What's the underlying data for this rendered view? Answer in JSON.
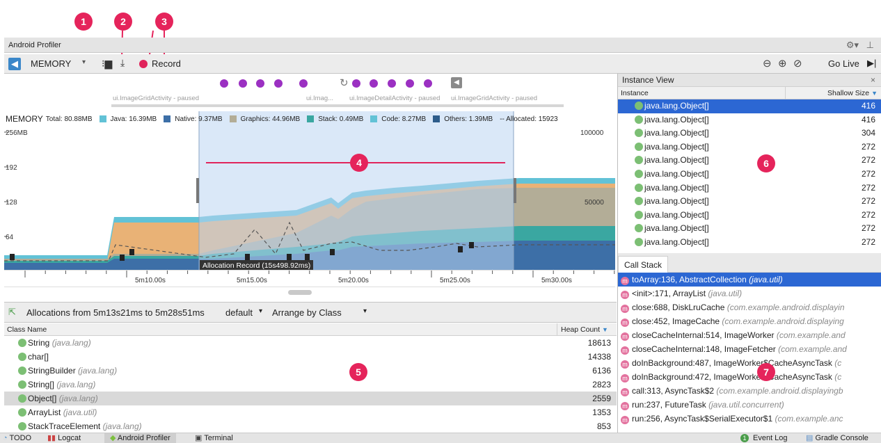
{
  "callouts": [
    "1",
    "2",
    "3",
    "4",
    "5",
    "6",
    "7"
  ],
  "window": {
    "title": "Android Profiler"
  },
  "toolbar": {
    "profiler_select": "MEMORY",
    "record_label": "Record",
    "go_live": "Go Live"
  },
  "events": {
    "activities": [
      "ui.ImageGridActivity - paused",
      "ui.Imag...",
      "ui.ImageDetailActivity - paused",
      "ui.ImageGridActivity - paused"
    ]
  },
  "chart": {
    "title": "MEMORY",
    "legend": {
      "total": "Total: 80.88MB",
      "java": "Java: 16.39MB",
      "native": "Native: 9.37MB",
      "graphics": "Graphics: 44.96MB",
      "stack": "Stack: 0.49MB",
      "code": "Code: 8.27MB",
      "others": "Others: 1.39MB",
      "allocated": "-- Allocated: 15923"
    },
    "colors": {
      "java": "#e9b276",
      "native": "#3d6fa7",
      "graphics": "#b3ad97",
      "stack": "#3aa7a1",
      "code": "#62c2d6",
      "others": "#2d5c8a",
      "selection": "#bcd6f3",
      "record": "#e0245b"
    },
    "allocation_tooltip": "Allocation Record (15s498.92ms)"
  },
  "chart_data": {
    "type": "area",
    "x_tick_labels": [
      "5m10.00s",
      "5m15.00s",
      "5m20.00s",
      "5m25.00s",
      "5m30.00s"
    ],
    "y_left_ticks": [
      "256MB",
      "192",
      "128",
      "64"
    ],
    "y_right_ticks": [
      "100000",
      "50000"
    ],
    "ylim_left": [
      0,
      256
    ],
    "ylim_right": [
      0,
      100000
    ],
    "series": [
      {
        "name": "Java",
        "values": [
          16.39
        ]
      },
      {
        "name": "Native",
        "values": [
          9.37
        ]
      },
      {
        "name": "Graphics",
        "values": [
          44.96
        ]
      },
      {
        "name": "Stack",
        "values": [
          0.49
        ]
      },
      {
        "name": "Code",
        "values": [
          8.27
        ]
      },
      {
        "name": "Others",
        "values": [
          1.39
        ]
      }
    ],
    "allocated": 15923,
    "total_mb": 80.88
  },
  "allocations": {
    "range_label": "Allocations from 5m13s21ms to 5m28s51ms",
    "heap_select": "default",
    "arrange_select": "Arrange by Class",
    "columns": [
      "Class Name",
      "Heap Count"
    ],
    "rows": [
      {
        "name": "String",
        "pkg": "(java.lang)",
        "count": "18613"
      },
      {
        "name": "char[]",
        "pkg": "",
        "count": "14338"
      },
      {
        "name": "StringBuilder",
        "pkg": "(java.lang)",
        "count": "6136"
      },
      {
        "name": "String[]",
        "pkg": "(java.lang)",
        "count": "2823"
      },
      {
        "name": "Object[]",
        "pkg": "(java.lang)",
        "count": "2559"
      },
      {
        "name": "ArrayList",
        "pkg": "(java.util)",
        "count": "1353"
      },
      {
        "name": "StackTraceElement",
        "pkg": "(java.lang)",
        "count": "853"
      }
    ]
  },
  "instance_view": {
    "title": "Instance View",
    "close": "×",
    "columns": [
      "Instance",
      "Shallow Size"
    ],
    "rows": [
      {
        "name": "java.lang.Object[]",
        "size": "416"
      },
      {
        "name": "java.lang.Object[]",
        "size": "416"
      },
      {
        "name": "java.lang.Object[]",
        "size": "304"
      },
      {
        "name": "java.lang.Object[]",
        "size": "272"
      },
      {
        "name": "java.lang.Object[]",
        "size": "272"
      },
      {
        "name": "java.lang.Object[]",
        "size": "272"
      },
      {
        "name": "java.lang.Object[]",
        "size": "272"
      },
      {
        "name": "java.lang.Object[]",
        "size": "272"
      },
      {
        "name": "java.lang.Object[]",
        "size": "272"
      },
      {
        "name": "java.lang.Object[]",
        "size": "272"
      },
      {
        "name": "java.lang.Object[]",
        "size": "272"
      }
    ]
  },
  "call_stack": {
    "tab": "Call Stack",
    "icon_letter": "m",
    "rows": [
      {
        "method": "toArray:136, AbstractCollection",
        "pkg": "(java.util)"
      },
      {
        "method": "<init>:171, ArrayList",
        "pkg": "(java.util)"
      },
      {
        "method": "close:688, DiskLruCache",
        "pkg": "(com.example.android.displayin"
      },
      {
        "method": "close:452, ImageCache",
        "pkg": "(com.example.android.displaying"
      },
      {
        "method": "closeCacheInternal:514, ImageWorker",
        "pkg": "(com.example.and"
      },
      {
        "method": "closeCacheInternal:148, ImageFetcher",
        "pkg": "(com.example.and"
      },
      {
        "method": "doInBackground:487, ImageWorker$CacheAsyncTask",
        "pkg": "(c"
      },
      {
        "method": "doInBackground:472, ImageWorker$CacheAsyncTask",
        "pkg": "(c"
      },
      {
        "method": "call:313, AsyncTask$2",
        "pkg": "(com.example.android.displayingb"
      },
      {
        "method": "run:237, FutureTask",
        "pkg": "(java.util.concurrent)"
      },
      {
        "method": "run:256, AsyncTask$SerialExecutor$1",
        "pkg": "(com.example.anc"
      }
    ]
  },
  "statusbar": {
    "todo": "TODO",
    "logcat": "Logcat",
    "profiler": "Android Profiler",
    "terminal": "Terminal",
    "event_log_count": "1",
    "event_log": "Event Log",
    "gradle": "Gradle Console"
  }
}
